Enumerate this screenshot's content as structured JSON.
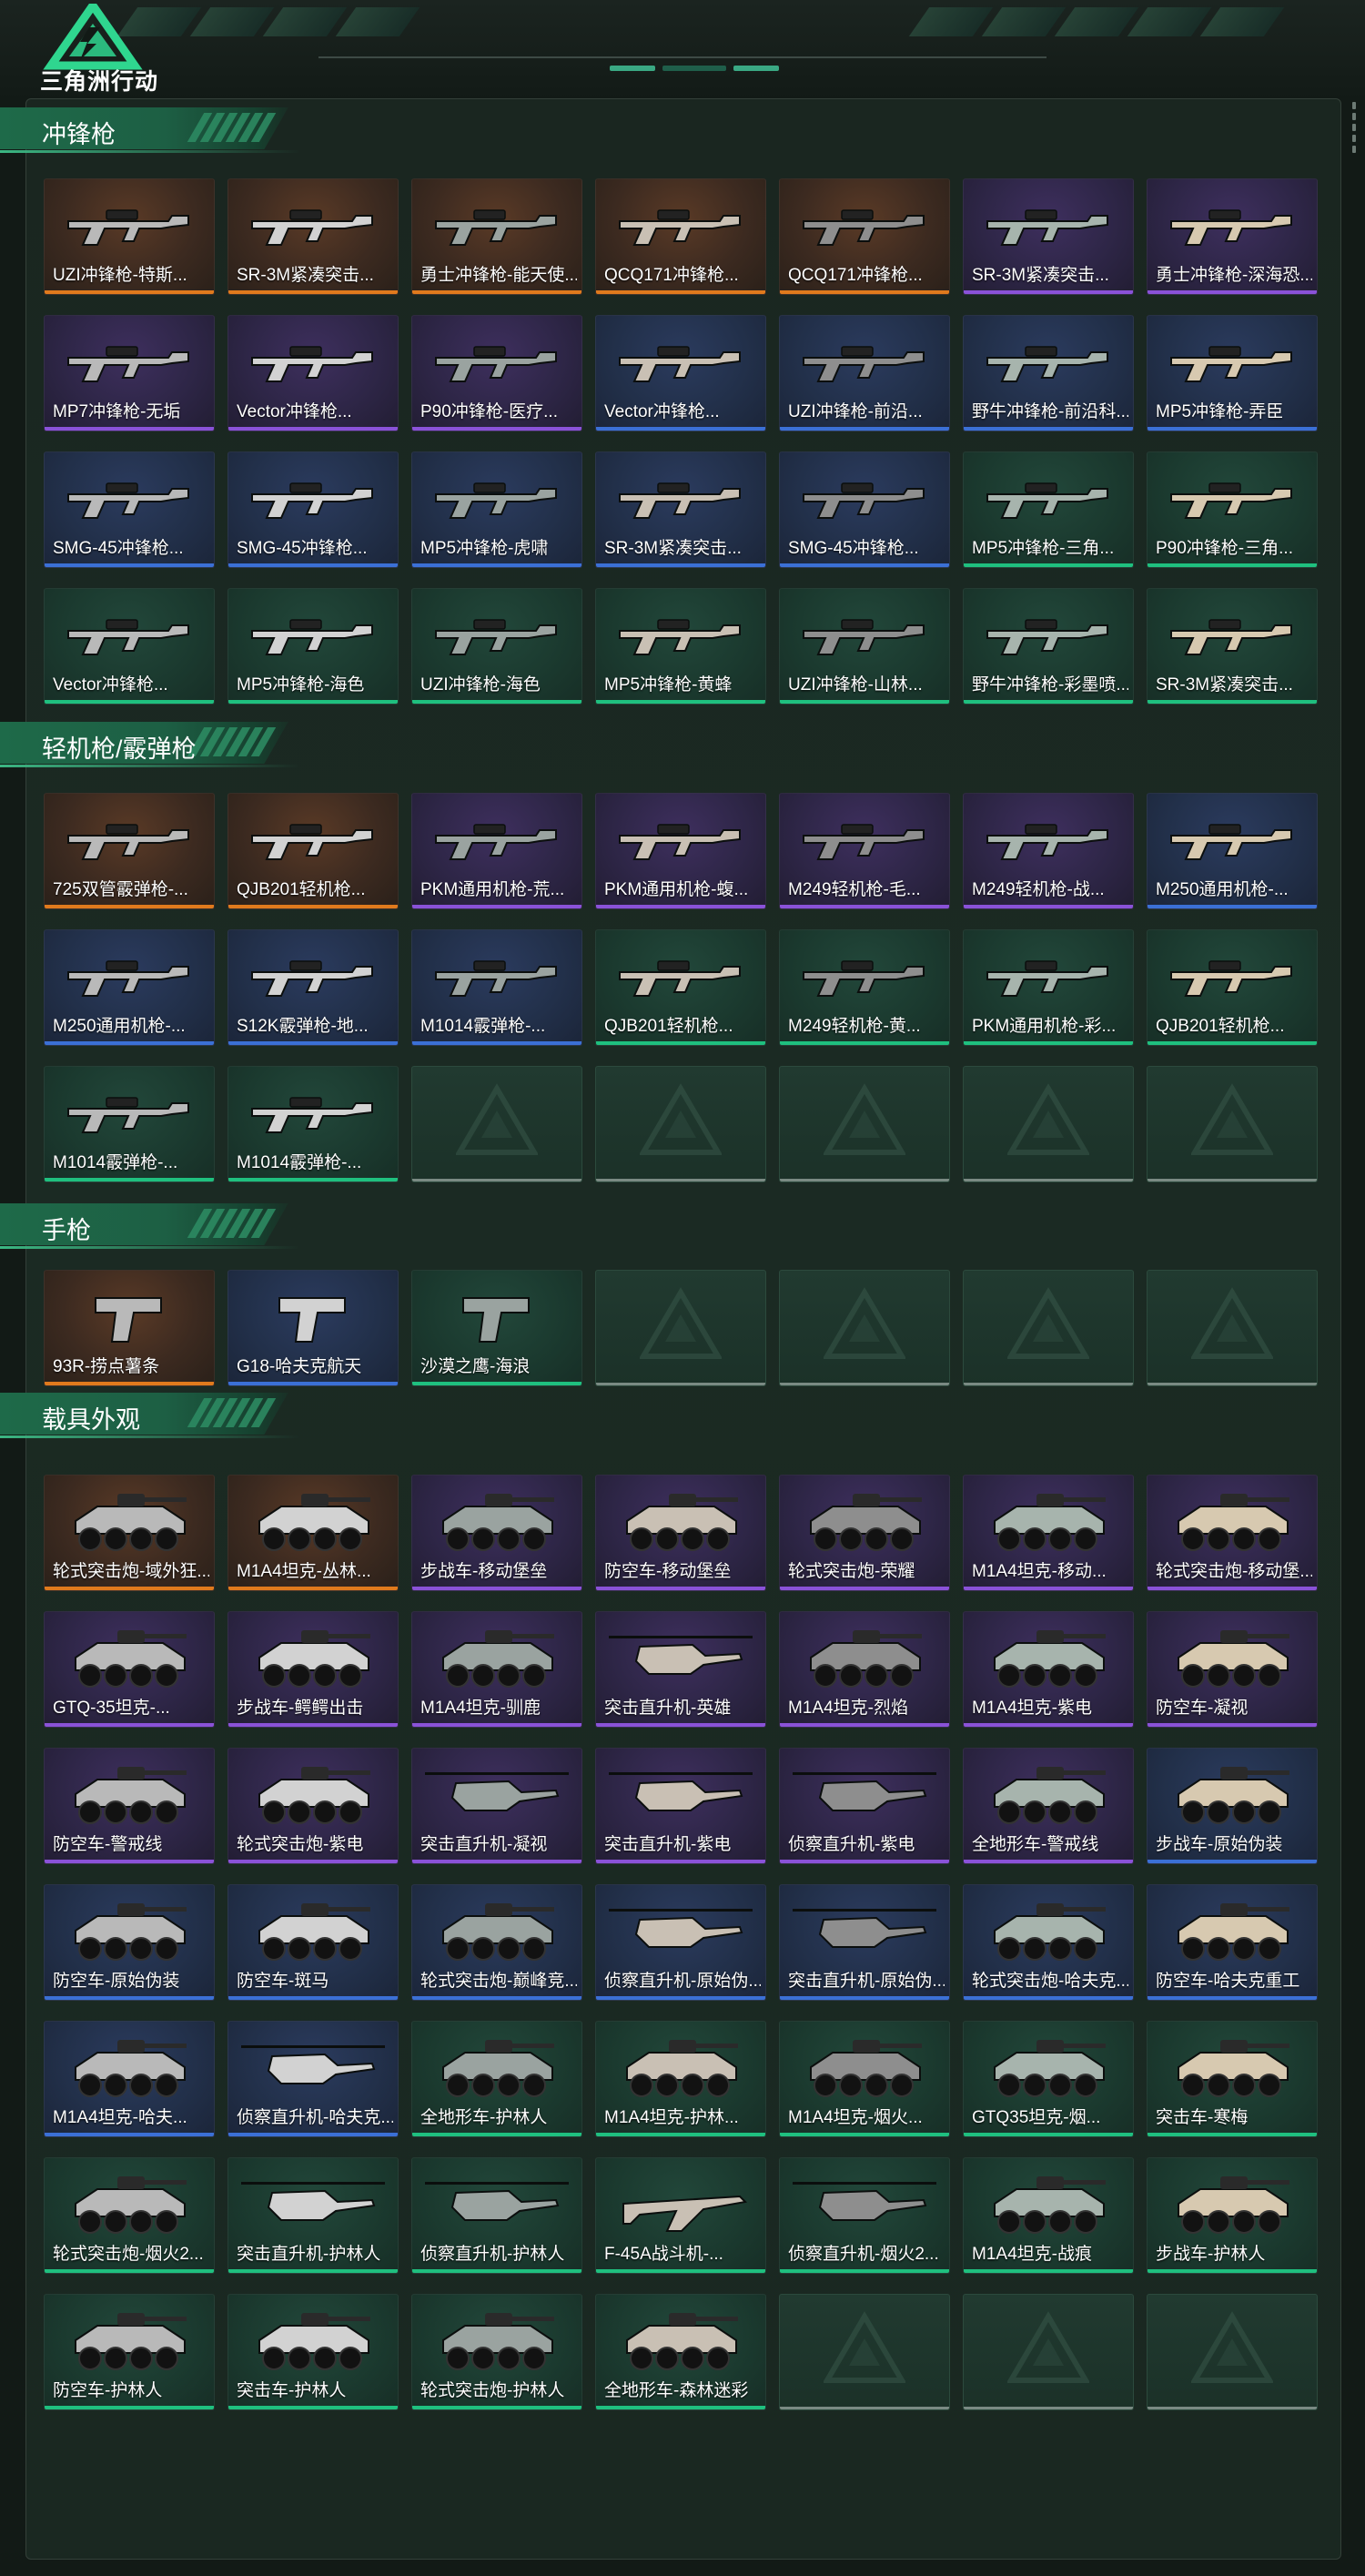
{
  "header": {
    "logo_text": "三角洲行动",
    "logo_icon": "delta-triangle-logo"
  },
  "colors": {
    "rarity_gold": "#e07a1d",
    "rarity_purple": "#8a52d8",
    "rarity_blue": "#3b70d6",
    "rarity_green": "#1fc07f",
    "accent": "#1e6a49"
  },
  "sections": [
    {
      "title": "冲锋枪",
      "kind": "gun",
      "items": [
        {
          "label": "UZI冲锋枪-特斯...",
          "rarity": "gold"
        },
        {
          "label": "SR-3M紧凑突击...",
          "rarity": "gold"
        },
        {
          "label": "勇士冲锋枪-能天使...",
          "rarity": "gold"
        },
        {
          "label": "QCQ171冲锋枪...",
          "rarity": "gold"
        },
        {
          "label": "QCQ171冲锋枪...",
          "rarity": "gold"
        },
        {
          "label": "SR-3M紧凑突击...",
          "rarity": "purple"
        },
        {
          "label": "勇士冲锋枪-深海恐...",
          "rarity": "purple"
        },
        {
          "label": "MP7冲锋枪-无垢",
          "rarity": "purple"
        },
        {
          "label": "Vector冲锋枪...",
          "rarity": "purple"
        },
        {
          "label": "P90冲锋枪-医疗...",
          "rarity": "purple"
        },
        {
          "label": "Vector冲锋枪...",
          "rarity": "blue"
        },
        {
          "label": "UZI冲锋枪-前沿...",
          "rarity": "blue"
        },
        {
          "label": "野牛冲锋枪-前沿科...",
          "rarity": "blue"
        },
        {
          "label": "MP5冲锋枪-弄臣",
          "rarity": "blue"
        },
        {
          "label": "SMG-45冲锋枪...",
          "rarity": "blue"
        },
        {
          "label": "SMG-45冲锋枪...",
          "rarity": "blue"
        },
        {
          "label": "MP5冲锋枪-虎啸",
          "rarity": "blue"
        },
        {
          "label": "SR-3M紧凑突击...",
          "rarity": "blue"
        },
        {
          "label": "SMG-45冲锋枪...",
          "rarity": "blue"
        },
        {
          "label": "MP5冲锋枪-三角...",
          "rarity": "green"
        },
        {
          "label": "P90冲锋枪-三角...",
          "rarity": "green"
        },
        {
          "label": "Vector冲锋枪...",
          "rarity": "green"
        },
        {
          "label": "MP5冲锋枪-海色",
          "rarity": "green"
        },
        {
          "label": "UZI冲锋枪-海色",
          "rarity": "green"
        },
        {
          "label": "MP5冲锋枪-黄蜂",
          "rarity": "green"
        },
        {
          "label": "UZI冲锋枪-山林...",
          "rarity": "green"
        },
        {
          "label": "野牛冲锋枪-彩墨喷...",
          "rarity": "green"
        },
        {
          "label": "SR-3M紧凑突击...",
          "rarity": "green"
        }
      ]
    },
    {
      "title": "轻机枪/霰弹枪",
      "kind": "gun",
      "items": [
        {
          "label": "725双管霰弹枪-...",
          "rarity": "gold"
        },
        {
          "label": "QJB201轻机枪...",
          "rarity": "gold"
        },
        {
          "label": "PKM通用机枪-荒...",
          "rarity": "purple"
        },
        {
          "label": "PKM通用机枪-蝮...",
          "rarity": "purple"
        },
        {
          "label": "M249轻机枪-毛...",
          "rarity": "purple"
        },
        {
          "label": "M249轻机枪-战...",
          "rarity": "purple"
        },
        {
          "label": "M250通用机枪-...",
          "rarity": "blue"
        },
        {
          "label": "M250通用机枪-...",
          "rarity": "blue"
        },
        {
          "label": "S12K霰弹枪-地...",
          "rarity": "blue"
        },
        {
          "label": "M1014霰弹枪-...",
          "rarity": "blue"
        },
        {
          "label": "QJB201轻机枪...",
          "rarity": "green"
        },
        {
          "label": "M249轻机枪-黄...",
          "rarity": "green"
        },
        {
          "label": "PKM通用机枪-彩...",
          "rarity": "green"
        },
        {
          "label": "QJB201轻机枪...",
          "rarity": "green"
        },
        {
          "label": "M1014霰弹枪-...",
          "rarity": "green"
        },
        {
          "label": "M1014霰弹枪-...",
          "rarity": "green"
        }
      ]
    },
    {
      "title": "手枪",
      "kind": "pistol",
      "items": [
        {
          "label": "93R-捞点薯条",
          "rarity": "gold"
        },
        {
          "label": "G18-哈夫克航天",
          "rarity": "blue"
        },
        {
          "label": "沙漠之鹰-海浪",
          "rarity": "green"
        }
      ]
    },
    {
      "title": "载具外观",
      "kind": "vehicle",
      "items": [
        {
          "label": "轮式突击炮-域外狂...",
          "rarity": "gold"
        },
        {
          "label": "M1A4坦克-丛林...",
          "rarity": "gold"
        },
        {
          "label": "步战车-移动堡垒",
          "rarity": "purple"
        },
        {
          "label": "防空车-移动堡垒",
          "rarity": "purple"
        },
        {
          "label": "轮式突击炮-荣耀",
          "rarity": "purple"
        },
        {
          "label": "M1A4坦克-移动...",
          "rarity": "purple"
        },
        {
          "label": "轮式突击炮-移动堡...",
          "rarity": "purple"
        },
        {
          "label": "GTQ-35坦克-...",
          "rarity": "purple"
        },
        {
          "label": "步战车-鳄鳄出击",
          "rarity": "purple"
        },
        {
          "label": "M1A4坦克-驯鹿",
          "rarity": "purple"
        },
        {
          "label": "突击直升机-英雄",
          "rarity": "purple"
        },
        {
          "label": "M1A4坦克-烈焰",
          "rarity": "purple"
        },
        {
          "label": "M1A4坦克-紫电",
          "rarity": "purple"
        },
        {
          "label": "防空车-凝视",
          "rarity": "purple"
        },
        {
          "label": "防空车-警戒线",
          "rarity": "purple"
        },
        {
          "label": "轮式突击炮-紫电",
          "rarity": "purple"
        },
        {
          "label": "突击直升机-凝视",
          "rarity": "purple"
        },
        {
          "label": "突击直升机-紫电",
          "rarity": "purple"
        },
        {
          "label": "侦察直升机-紫电",
          "rarity": "purple"
        },
        {
          "label": "全地形车-警戒线",
          "rarity": "purple"
        },
        {
          "label": "步战车-原始伪装",
          "rarity": "blue"
        },
        {
          "label": "防空车-原始伪装",
          "rarity": "blue"
        },
        {
          "label": "防空车-斑马",
          "rarity": "blue"
        },
        {
          "label": "轮式突击炮-巅峰竞...",
          "rarity": "blue"
        },
        {
          "label": "侦察直升机-原始伪...",
          "rarity": "blue"
        },
        {
          "label": "突击直升机-原始伪...",
          "rarity": "blue"
        },
        {
          "label": "轮式突击炮-哈夫克...",
          "rarity": "blue"
        },
        {
          "label": "防空车-哈夫克重工",
          "rarity": "blue"
        },
        {
          "label": "M1A4坦克-哈夫...",
          "rarity": "blue"
        },
        {
          "label": "侦察直升机-哈夫克...",
          "rarity": "blue"
        },
        {
          "label": "全地形车-护林人",
          "rarity": "green"
        },
        {
          "label": "M1A4坦克-护林...",
          "rarity": "green"
        },
        {
          "label": "M1A4坦克-烟火...",
          "rarity": "green"
        },
        {
          "label": "GTQ35坦克-烟...",
          "rarity": "green"
        },
        {
          "label": "突击车-寒梅",
          "rarity": "green"
        },
        {
          "label": "轮式突击炮-烟火2...",
          "rarity": "green"
        },
        {
          "label": "突击直升机-护林人",
          "rarity": "green"
        },
        {
          "label": "侦察直升机-护林人",
          "rarity": "green"
        },
        {
          "label": "F-45A战斗机-...",
          "rarity": "green"
        },
        {
          "label": "侦察直升机-烟火2...",
          "rarity": "green"
        },
        {
          "label": "M1A4坦克-战痕",
          "rarity": "green"
        },
        {
          "label": "步战车-护林人",
          "rarity": "green"
        },
        {
          "label": "防空车-护林人",
          "rarity": "green"
        },
        {
          "label": "突击车-护林人",
          "rarity": "green"
        },
        {
          "label": "轮式突击炮-护林人",
          "rarity": "green"
        },
        {
          "label": "全地形车-森林迷彩",
          "rarity": "green"
        }
      ]
    }
  ]
}
